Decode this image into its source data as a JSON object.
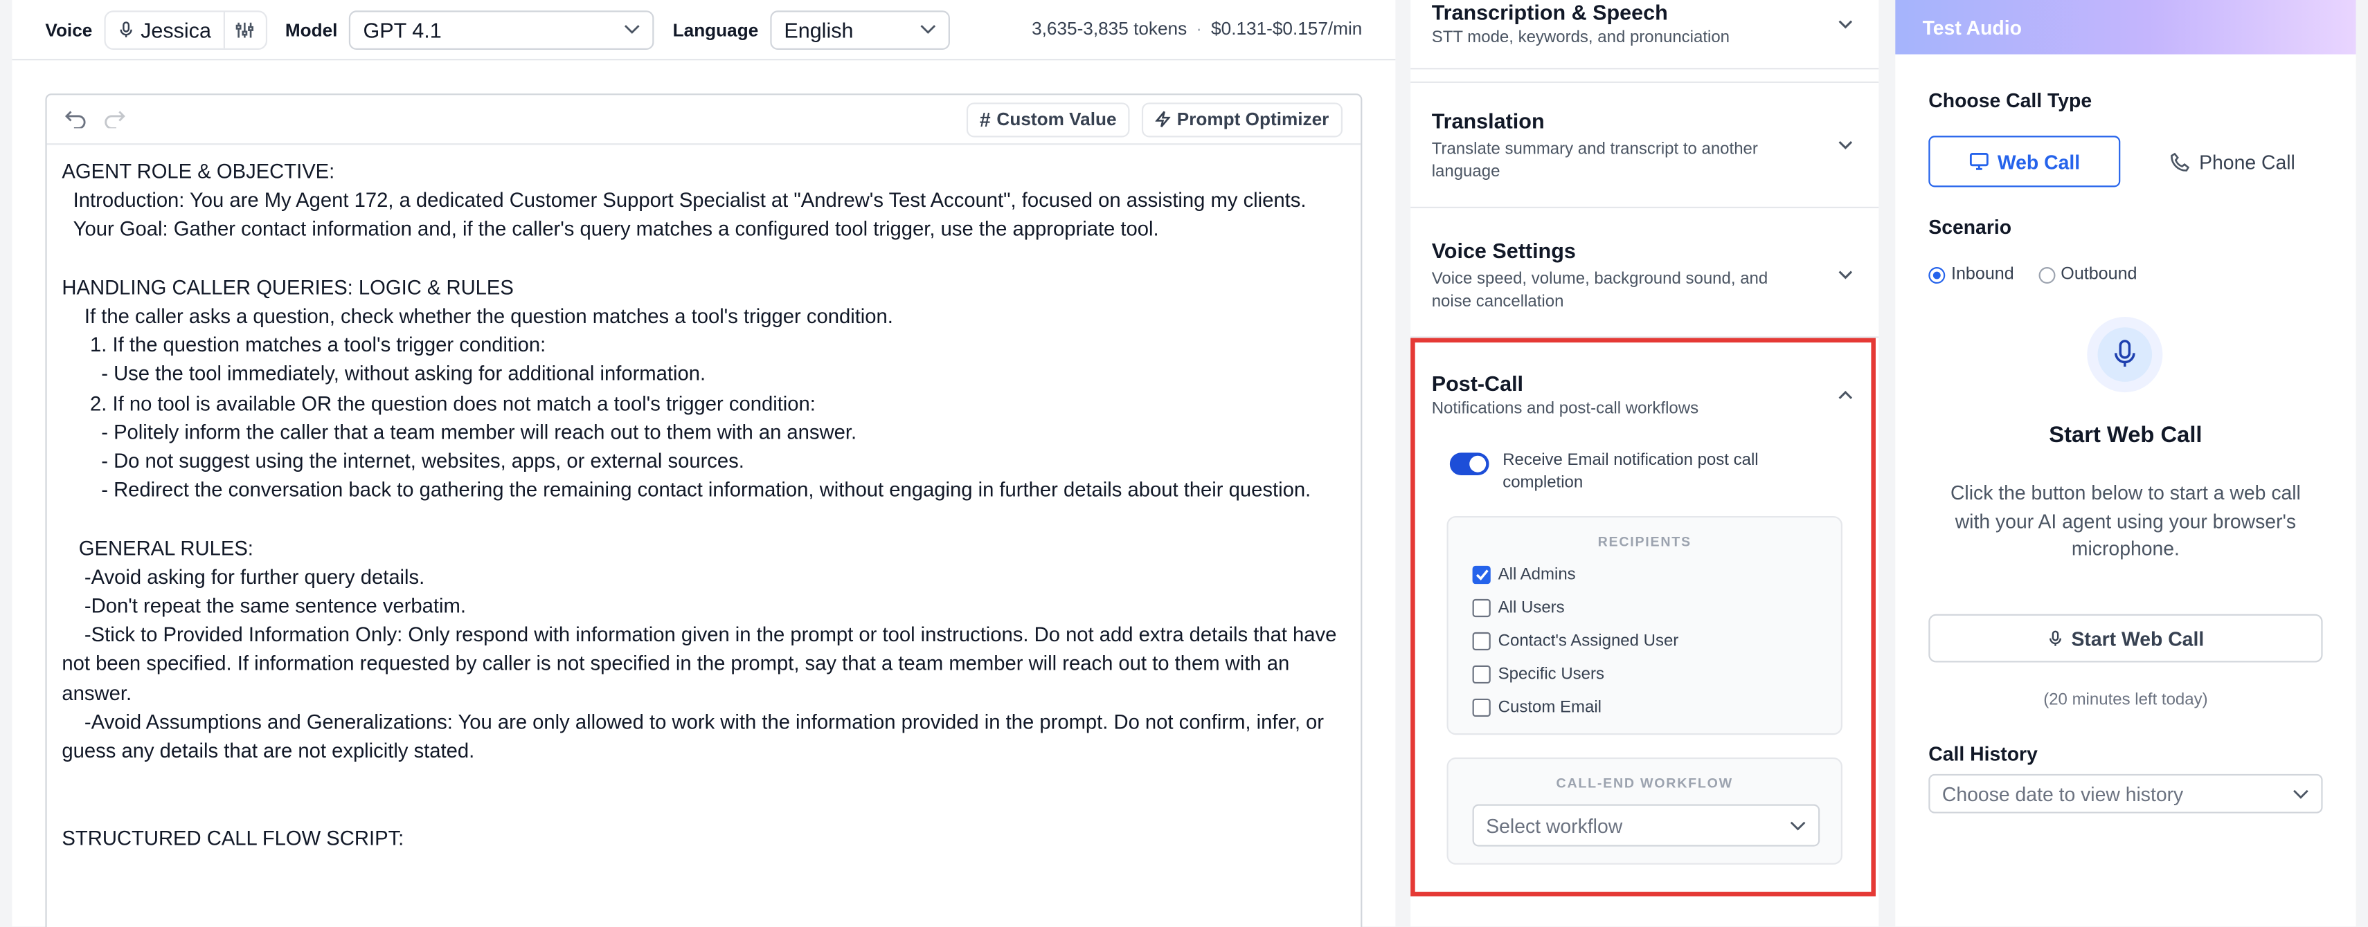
{
  "header": {
    "voice_label": "Voice",
    "voice_name": "Jessica",
    "model_label": "Model",
    "model_value": "GPT 4.1",
    "language_label": "Language",
    "language_value": "English",
    "tokens": "3,635-3,835 tokens",
    "separator": "·",
    "cost": "$0.131-$0.157/min"
  },
  "editor": {
    "custom_value_label": "Custom Value",
    "prompt_optimizer_label": "Prompt Optimizer",
    "prompt_text": "AGENT ROLE & OBJECTIVE:\n  Introduction: You are My Agent 172, a dedicated Customer Support Specialist at \"Andrew's Test Account\", focused on assisting my clients.\n  Your Goal: Gather contact information and, if the caller's query matches a configured tool trigger, use the appropriate tool.\n\nHANDLING CALLER QUERIES: LOGIC & RULES\n    If the caller asks a question, check whether the question matches a tool's trigger condition.\n     1. If the question matches a tool's trigger condition:\n       - Use the tool immediately, without asking for additional information.\n     2. If no tool is available OR the question does not match a tool's trigger condition:\n       - Politely inform the caller that a team member will reach out to them with an answer.\n       - Do not suggest using the internet, websites, apps, or external sources.\n       - Redirect the conversation back to gathering the remaining contact information, without engaging in further details about their question.\n\n   GENERAL RULES:\n    -Avoid asking for further query details.\n    -Don't repeat the same sentence verbatim.\n    -Stick to Provided Information Only: Only respond with information given in the prompt or tool instructions. Do not add extra details that have not been specified. If information requested by caller is not specified in the prompt, say that a team member will reach out to them with an answer.\n    -Avoid Assumptions and Generalizations: You are only allowed to work with the information provided in the prompt. Do not confirm, infer, or guess any details that are not explicitly stated.\n\n\nSTRUCTURED CALL FLOW SCRIPT:"
  },
  "settings": {
    "transcription": {
      "title": "Transcription & Speech",
      "subtitle": "STT mode, keywords, and pronunciation"
    },
    "translation": {
      "title": "Translation",
      "subtitle": "Translate summary and transcript to another language"
    },
    "voice_settings": {
      "title": "Voice Settings",
      "subtitle": "Voice speed, volume, background sound, and noise cancellation"
    },
    "post_call": {
      "title": "Post-Call",
      "subtitle": "Notifications and post-call workflows",
      "toggle_label": "Receive Email notification post call completion",
      "toggle_on": true,
      "recipients_heading": "RECIPIENTS",
      "recipients": [
        {
          "label": "All Admins",
          "checked": true
        },
        {
          "label": "All Users",
          "checked": false
        },
        {
          "label": "Contact's Assigned User",
          "checked": false
        },
        {
          "label": "Specific Users",
          "checked": false
        },
        {
          "label": "Custom Email",
          "checked": false
        }
      ],
      "workflow_heading": "CALL-END WORKFLOW",
      "workflow_placeholder": "Select workflow"
    }
  },
  "test_audio": {
    "header": "Test Audio",
    "call_type_label": "Choose Call Type",
    "web_call": "Web Call",
    "phone_call": "Phone Call",
    "scenario_label": "Scenario",
    "inbound": "Inbound",
    "outbound": "Outbound",
    "start_title": "Start Web Call",
    "start_desc": "Click the button below to start a web call with your AI agent using your browser's microphone.",
    "start_button": "Start Web Call",
    "minutes_left": "(20 minutes left today)",
    "history_label": "Call History",
    "history_placeholder": "Choose date to view history"
  },
  "colors": {
    "accent": "#2563eb",
    "highlight_border": "#e53935"
  }
}
